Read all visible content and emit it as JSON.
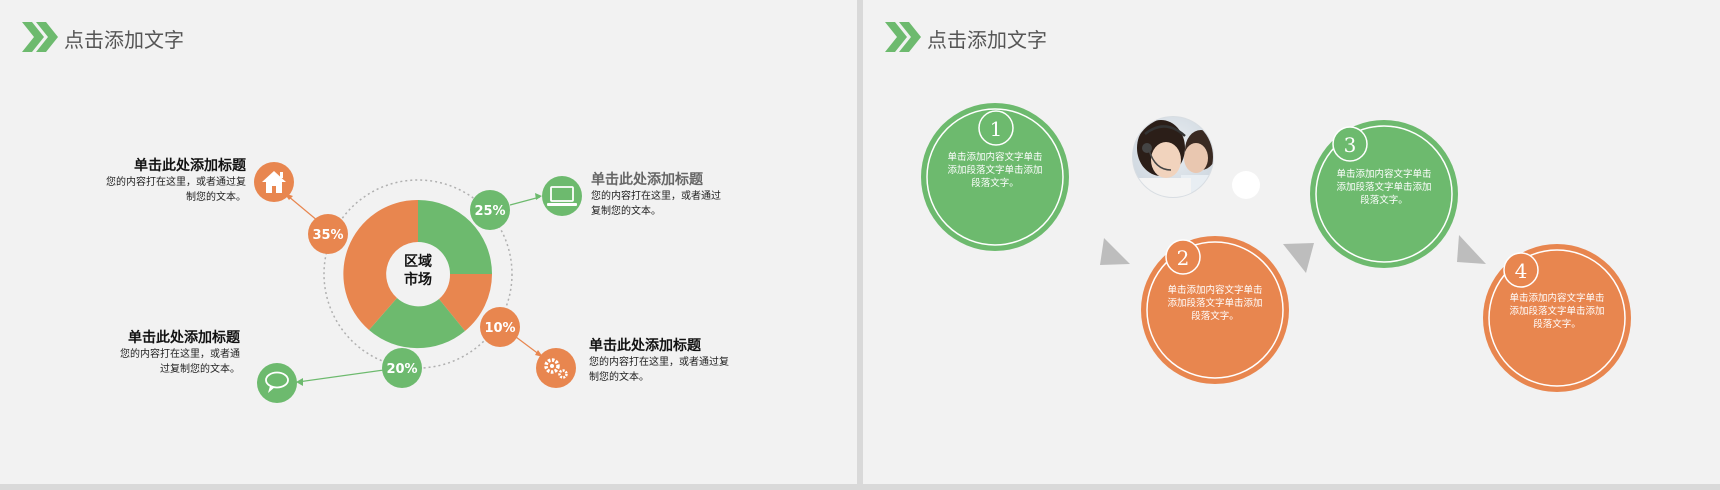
{
  "slide_left": {
    "title": "点击添加文字",
    "center_label_line1": "区域",
    "center_label_line2": "市场",
    "percentages": [
      "35%",
      "25%",
      "10%",
      "20%"
    ],
    "blocks": [
      {
        "title": "单击此处添加标题",
        "body_line1": "您的内容打在这里，或者通过复",
        "body_line2": "制您的文本。",
        "icon": "house-icon"
      },
      {
        "title": "单击此处添加标题",
        "body_line1": "您的内容打在这里，或者通过",
        "body_line2": "复制您的文本。",
        "icon": "laptop-icon"
      },
      {
        "title": "单击此处添加标题",
        "body_line1": "您的内容打在这里，或者通",
        "body_line2": "过复制您的文本。",
        "icon": "chat-bubble-icon"
      },
      {
        "title": "单击此处添加标题",
        "body_line1": "您的内容打在这里，或者通过复",
        "body_line2": "制您的文本。",
        "icon": "gears-icon"
      }
    ],
    "colors": {
      "green": "#6dba6e",
      "orange": "#e8864f",
      "grey_text": "#666666"
    }
  },
  "slide_right": {
    "title": "点击添加文字",
    "steps": [
      {
        "number": "1",
        "l1": "单击添加内容文字单击",
        "l2": "添加段落文字单击添加",
        "l3": "段落文字。",
        "color": "#6dba6e"
      },
      {
        "number": "2",
        "l1": "单击添加内容文字单击",
        "l2": "添加段落文字单击添加",
        "l3": "段落文字。",
        "color": "#e8864f"
      },
      {
        "number": "3",
        "l1": "单击添加内容文字单击",
        "l2": "添加段落文字单击添加",
        "l3": "段落文字。",
        "color": "#6dba6e"
      },
      {
        "number": "4",
        "l1": "单击添加内容文字单击",
        "l2": "添加段落文字单击添加",
        "l3": "段落文字。",
        "color": "#e8864f"
      }
    ]
  }
}
